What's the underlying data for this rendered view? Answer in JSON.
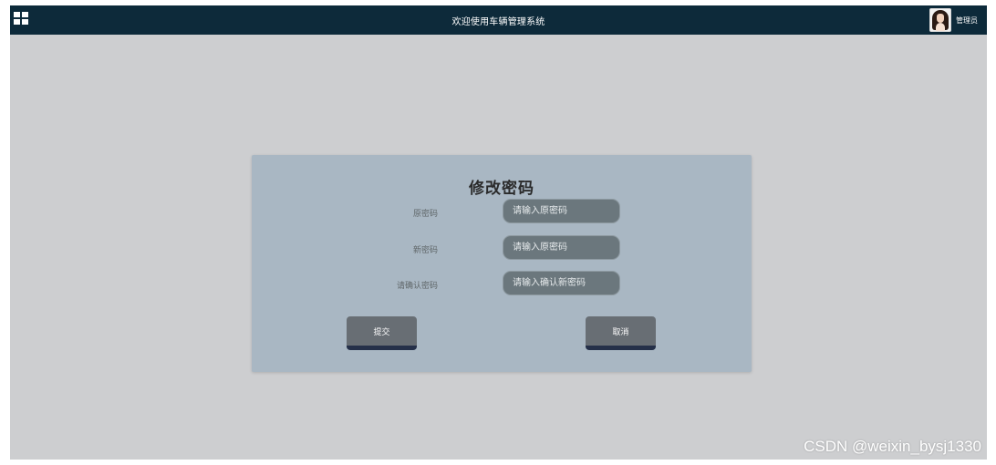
{
  "header": {
    "title": "欢迎使用车辆管理系统",
    "menu_icon": "grid-menu-icon",
    "user": {
      "name": "管理员",
      "avatar_icon": "user-avatar-icon"
    }
  },
  "form": {
    "title": "修改密码",
    "fields": [
      {
        "label": "原密码",
        "placeholder": "请输入原密码",
        "value": ""
      },
      {
        "label": "新密码",
        "placeholder": "请输入原密码",
        "value": ""
      },
      {
        "label": "请确认密码",
        "placeholder": "请输入确认新密码",
        "value": ""
      }
    ],
    "submit_label": "提交",
    "cancel_label": "取消"
  },
  "watermark": "CSDN @weixin_bysj1330",
  "colors": {
    "header_bg": "#0d2a3a",
    "page_bg": "#cdced0",
    "card_bg": "#a9b7c3",
    "input_bg": "#6b777d",
    "button_bg": "#686e74",
    "button_shadow": "#253049"
  }
}
